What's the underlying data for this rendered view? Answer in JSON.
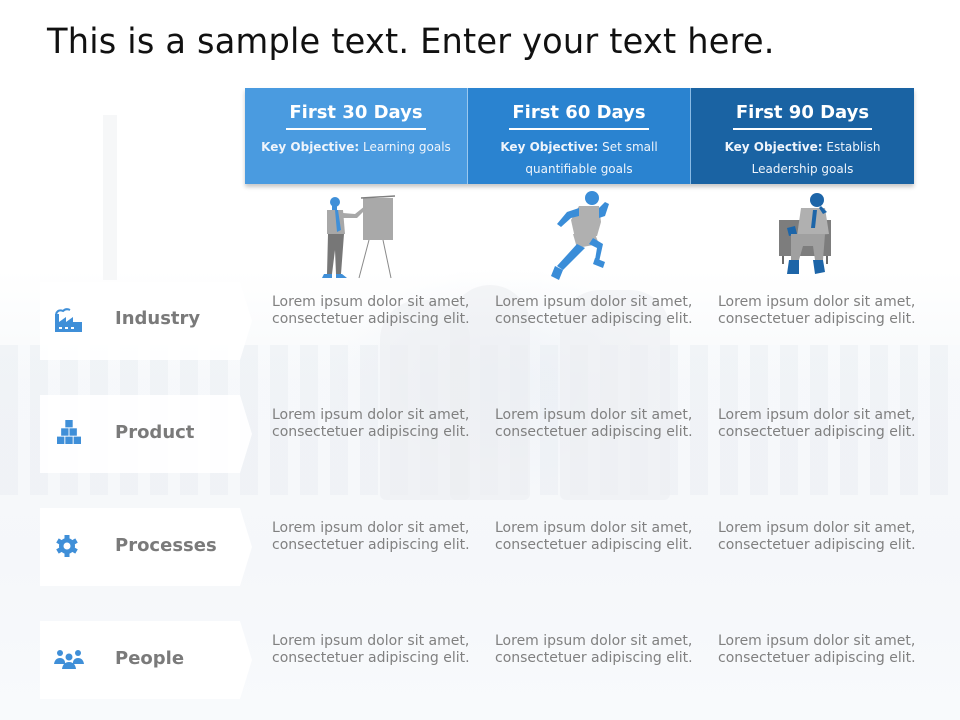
{
  "title": "This is a sample text. Enter your text here.",
  "colors": {
    "col1": "#4a9be0",
    "col2": "#2a83d0",
    "col3": "#1a63a3",
    "accent": "#3f8fd8",
    "label": "#7a7a7a",
    "body_text": "#808080"
  },
  "columns": [
    {
      "heading": "First 30 Days",
      "objective_label": "Key Objective:",
      "objective_text": "Learning goals",
      "figure": "presenter-at-flipchart"
    },
    {
      "heading": "First 60 Days",
      "objective_label": "Key Objective:",
      "objective_text": "Set small quantifiable goals",
      "figure": "running-man"
    },
    {
      "heading": "First 90 Days",
      "objective_label": "Key Objective:",
      "objective_text": "Establish Leadership goals",
      "figure": "seated-businessman"
    }
  ],
  "rows": [
    {
      "label": "Industry",
      "icon": "factory-icon",
      "cells": [
        "Lorem ipsum dolor sit amet, consectetuer adipiscing elit.",
        "Lorem ipsum dolor sit amet, consectetuer adipiscing elit.",
        "Lorem ipsum dolor sit amet, consectetuer adipiscing elit."
      ]
    },
    {
      "label": "Product",
      "icon": "boxes-icon",
      "cells": [
        "Lorem ipsum dolor sit amet, consectetuer adipiscing elit.",
        "Lorem ipsum dolor sit amet, consectetuer adipiscing elit.",
        "Lorem ipsum dolor sit amet, consectetuer adipiscing elit."
      ]
    },
    {
      "label": "Processes",
      "icon": "gear-icon",
      "cells": [
        "Lorem ipsum dolor sit amet, consectetuer adipiscing elit.",
        "Lorem ipsum dolor sit amet, consectetuer adipiscing elit.",
        "Lorem ipsum dolor sit amet, consectetuer adipiscing elit."
      ]
    },
    {
      "label": "People",
      "icon": "people-icon",
      "cells": [
        "Lorem ipsum dolor sit amet, consectetuer adipiscing elit.",
        "Lorem ipsum dolor sit amet, consectetuer adipiscing elit.",
        "Lorem ipsum dolor sit amet, consectetuer adipiscing elit."
      ]
    }
  ]
}
